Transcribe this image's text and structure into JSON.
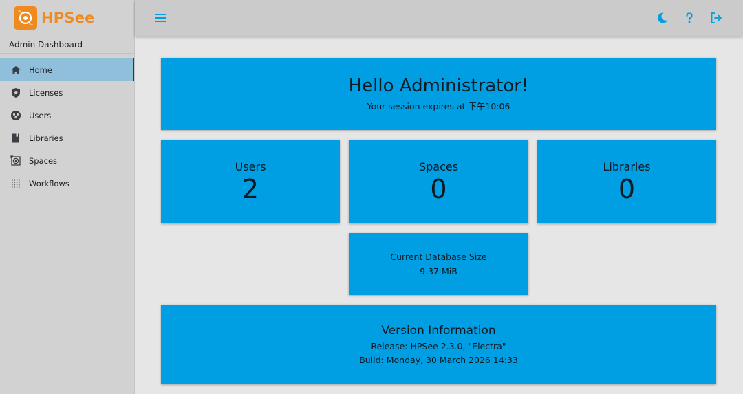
{
  "brand": {
    "name": "HPSee",
    "color": "#ef8a1f"
  },
  "sidebar": {
    "subtitle": "Admin Dashboard",
    "items": [
      {
        "label": "Home",
        "icon": "home-icon",
        "active": true
      },
      {
        "label": "Licenses",
        "icon": "shield-star-icon",
        "active": false
      },
      {
        "label": "Users",
        "icon": "users-group-icon",
        "active": false
      },
      {
        "label": "Libraries",
        "icon": "book-icon",
        "active": false
      },
      {
        "label": "Spaces",
        "icon": "spaces-icon",
        "active": false
      },
      {
        "label": "Workflows",
        "icon": "workflow-grid-icon",
        "active": false
      }
    ]
  },
  "topbar": {
    "icons": [
      "menu-icon",
      "moon-icon",
      "help-icon",
      "logout-icon"
    ],
    "accent": "#009ee3"
  },
  "hello": {
    "title": "Hello Administrator!",
    "session": "Your session expires at 下午10:06"
  },
  "stats": [
    {
      "label": "Users",
      "value": "2"
    },
    {
      "label": "Spaces",
      "value": "0"
    },
    {
      "label": "Libraries",
      "value": "0"
    }
  ],
  "database": {
    "label": "Current Database Size",
    "value": "9.37 MiB"
  },
  "version": {
    "title": "Version Information",
    "release": "Release: HPSee 2.3.0, \"Electra\"",
    "build": "Build: Monday, 30 March 2026 14:33"
  },
  "colors": {
    "card": "#009ee3",
    "sidebar_active": "#8fbfda",
    "background": "#e6e6e6"
  }
}
